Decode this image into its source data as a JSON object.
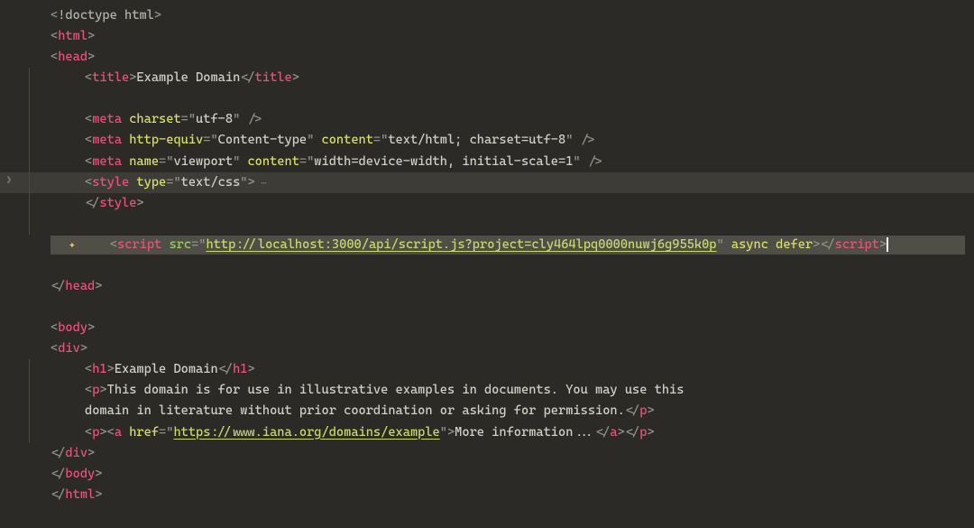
{
  "code": {
    "doctype_bang": "!",
    "doctype": "doctype",
    "doctype_kw": "html",
    "html_tag": "html",
    "head_tag": "head",
    "title_tag": "title",
    "title_text": "Example Domain",
    "meta_tag": "meta",
    "charset_attr": "charset",
    "charset_val": "utf-8",
    "httpequiv_attr": "http-equiv",
    "httpequiv_val": "Content-type",
    "content_attr": "content",
    "content_val1": "text/html; charset=utf-8",
    "name_attr": "name",
    "name_val": "viewport",
    "content_val2": "width=device-width, initial-scale=1",
    "style_tag": "style",
    "type_attr": "type",
    "type_val": "text/css",
    "script_tag": "script",
    "src_attr": "src",
    "script_url": "http://localhost:3000/api/script.js?project=cly464lpq0000nuwj6g955k0p",
    "async_attr": "async",
    "defer_attr": "defer",
    "body_tag": "body",
    "div_tag": "div",
    "h1_tag": "h1",
    "h1_text": "Example Domain",
    "p_tag": "p",
    "p1_text1": "This domain is for use in illustrative examples in documents. You may use this",
    "p1_text2": "domain in literature without prior coordination or asking for permission.",
    "a_tag": "a",
    "href_attr": "href",
    "href_val": "https://www.iana.org/domains/example",
    "a_text": "More information..."
  }
}
